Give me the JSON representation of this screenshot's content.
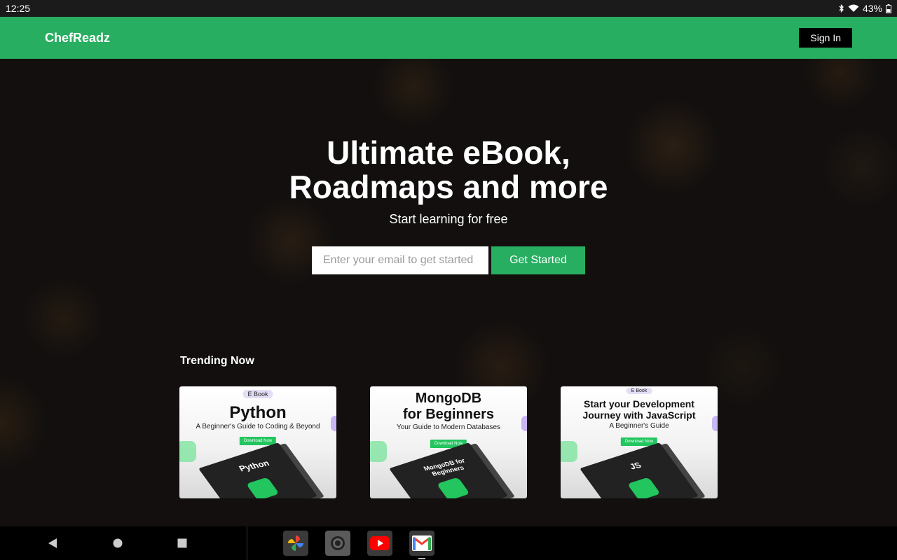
{
  "status_bar": {
    "time": "12:25",
    "battery": "43%"
  },
  "app_bar": {
    "logo": "ChefReadz",
    "sign_in_label": "Sign In"
  },
  "hero": {
    "headline_line1": "Ultimate eBook,",
    "headline_line2": "Roadmaps and more",
    "subheadline": "Start learning for free",
    "email_placeholder": "Enter your email to get started",
    "cta_label": "Get Started"
  },
  "trending": {
    "title": "Trending Now",
    "cards": [
      {
        "badge": "E Book",
        "title": "Python",
        "subtitle": "A Beginner's Guide to Coding & Beyond",
        "button": "Download Now",
        "book_title": "Python"
      },
      {
        "badge": "",
        "title_line1": "MongoDB",
        "title_line2": "for Beginners",
        "subtitle": "Your Guide to Modern Databases",
        "button": "Download Now",
        "book_title": "MongoDB for Beginners"
      },
      {
        "badge": "E Book",
        "title_line1": "Start your Development",
        "title_line2": "Journey with JavaScript",
        "subtitle": "A Beginner's Guide",
        "button": "Download Now",
        "book_title": "JS"
      }
    ]
  },
  "nav_bar": {
    "buttons": [
      "back",
      "home",
      "recents"
    ],
    "dock_apps": [
      "Photos",
      "Camera",
      "YouTube",
      "Gmail"
    ]
  },
  "colors": {
    "brand_green": "#27ae60",
    "status_bar": "#1b1b1b"
  }
}
